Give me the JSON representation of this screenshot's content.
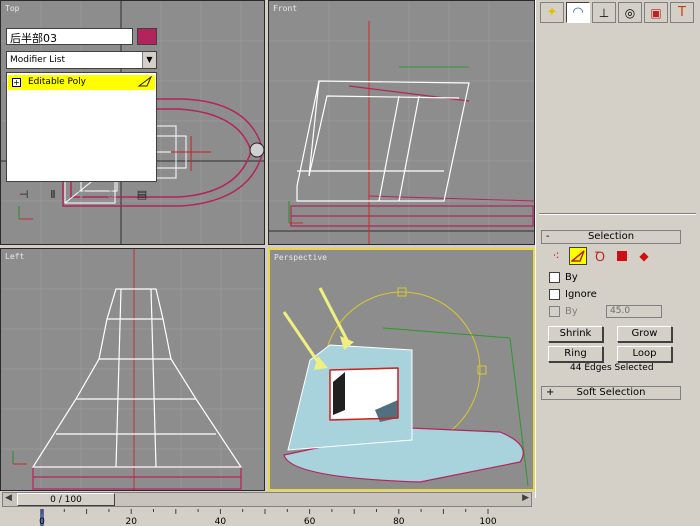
{
  "viewports": {
    "top": {
      "label": "Top"
    },
    "front": {
      "label": "Front"
    },
    "left": {
      "label": "Left"
    },
    "perspective": {
      "label": "Perspective"
    }
  },
  "command_panel": {
    "tabs": [
      "create-icon",
      "modify-icon",
      "hierarchy-icon",
      "motion-icon",
      "display-icon",
      "utilities-icon"
    ],
    "object_name": "后半部03",
    "object_color": "#b4245c",
    "modifier_list": "Modifier List",
    "stack_item": "Editable Poly",
    "selection_rollout": {
      "title": "Selection",
      "sign": "-",
      "by_vertex": "By",
      "ignore_backfacing": "Ignore",
      "by_angle": "By",
      "angle_value": "45.0",
      "shrink": "Shrink",
      "grow": "Grow",
      "ring": "Ring",
      "loop": "Loop",
      "status": "44 Edges Selected"
    },
    "soft_selection_rollout": {
      "title": "Soft Selection",
      "sign": "+"
    }
  },
  "timeline": {
    "frame_display": "0 / 100",
    "ticks": [
      "0",
      "20",
      "40",
      "60",
      "80",
      "100"
    ]
  },
  "colors": {
    "viewport_bg": "#8d8d8d",
    "wire_white": "#ffffff",
    "wire_magenta": "#b4245c",
    "selection_yellow": "#fefe00",
    "active_viewport_border": "#e6d84a"
  }
}
